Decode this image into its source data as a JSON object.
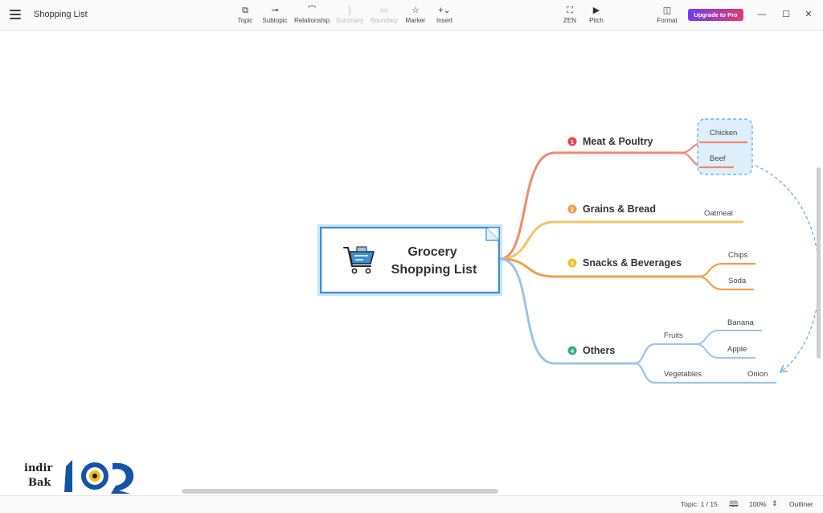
{
  "window": {
    "title": "Shopping List",
    "upgrade_label": "Upgrade to Pro"
  },
  "toolbar": {
    "topic": "Topic",
    "subtopic": "Subtopic",
    "relationship": "Relationship",
    "summary": "Summary",
    "boundary": "Boundary",
    "marker": "Marker",
    "insert": "Insert",
    "zen": "ZEN",
    "pitch": "Pitch",
    "format": "Format"
  },
  "mindmap": {
    "central": {
      "line1": "Grocery",
      "line2": "Shopping List"
    },
    "branches": [
      {
        "number": "1",
        "label": "Meat & Poultry",
        "color": "#f08a6e",
        "badge": "#e5484d",
        "children": [
          "Chicken",
          "Beef"
        ]
      },
      {
        "number": "2",
        "label": "Grains & Bread",
        "color": "#f5c463",
        "badge": "#f0a04b",
        "children": [
          "Oatmeal"
        ]
      },
      {
        "number": "3",
        "label": "Snacks & Beverages",
        "color": "#f0a04b",
        "badge": "#f5c026",
        "children": [
          "Chips",
          "Soda"
        ]
      },
      {
        "number": "4",
        "label": "Others",
        "color": "#9ec3e6",
        "badge": "#2fb37a",
        "groups": [
          {
            "label": "Fruits",
            "children": [
              "Banana",
              "Apple"
            ]
          },
          {
            "label": "Vegetables",
            "children": [
              "Onion"
            ]
          }
        ]
      }
    ],
    "boundary_color": "#5aa9e6"
  },
  "status": {
    "topic_count": "Topic: 1 / 15",
    "zoom": "100%",
    "outliner": "Outliner"
  },
  "watermark": {
    "line1": "indir",
    "line2": "Bak"
  }
}
